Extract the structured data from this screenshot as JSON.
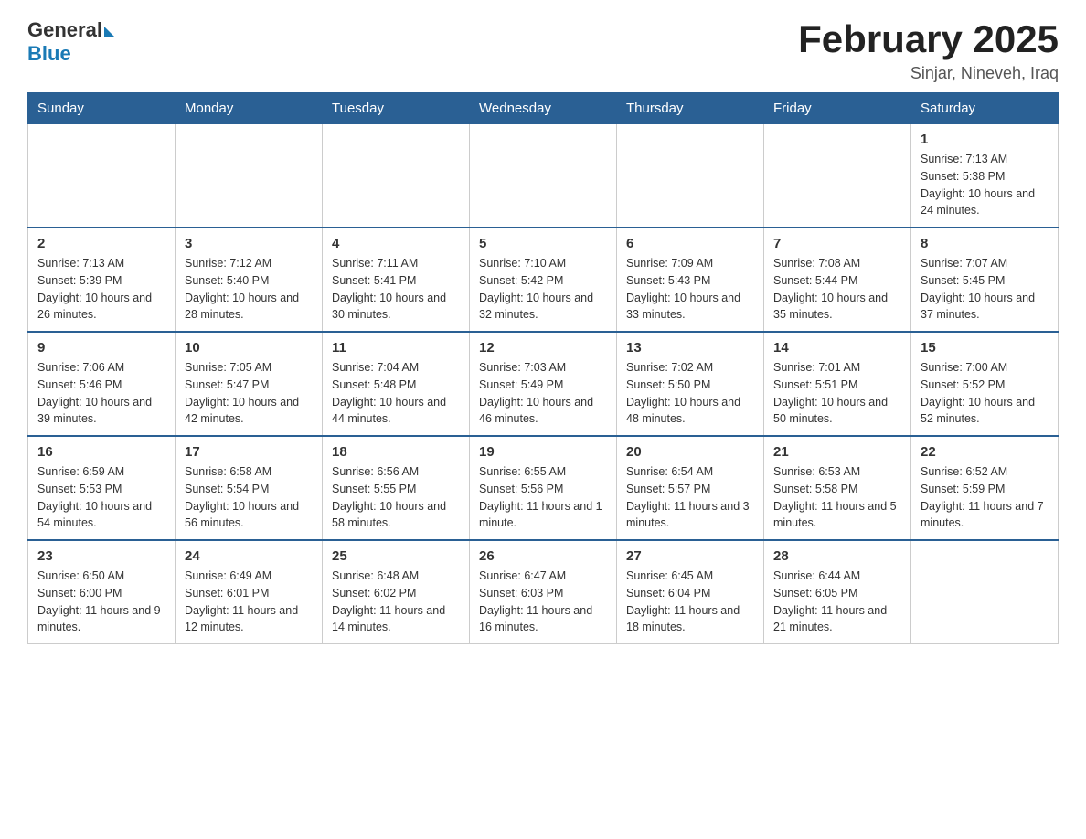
{
  "logo": {
    "general": "General",
    "blue": "Blue"
  },
  "title": "February 2025",
  "location": "Sinjar, Nineveh, Iraq",
  "days_of_week": [
    "Sunday",
    "Monday",
    "Tuesday",
    "Wednesday",
    "Thursday",
    "Friday",
    "Saturday"
  ],
  "weeks": [
    [
      {
        "day": "",
        "sunrise": "",
        "sunset": "",
        "daylight": ""
      },
      {
        "day": "",
        "sunrise": "",
        "sunset": "",
        "daylight": ""
      },
      {
        "day": "",
        "sunrise": "",
        "sunset": "",
        "daylight": ""
      },
      {
        "day": "",
        "sunrise": "",
        "sunset": "",
        "daylight": ""
      },
      {
        "day": "",
        "sunrise": "",
        "sunset": "",
        "daylight": ""
      },
      {
        "day": "",
        "sunrise": "",
        "sunset": "",
        "daylight": ""
      },
      {
        "day": "1",
        "sunrise": "Sunrise: 7:13 AM",
        "sunset": "Sunset: 5:38 PM",
        "daylight": "Daylight: 10 hours and 24 minutes."
      }
    ],
    [
      {
        "day": "2",
        "sunrise": "Sunrise: 7:13 AM",
        "sunset": "Sunset: 5:39 PM",
        "daylight": "Daylight: 10 hours and 26 minutes."
      },
      {
        "day": "3",
        "sunrise": "Sunrise: 7:12 AM",
        "sunset": "Sunset: 5:40 PM",
        "daylight": "Daylight: 10 hours and 28 minutes."
      },
      {
        "day": "4",
        "sunrise": "Sunrise: 7:11 AM",
        "sunset": "Sunset: 5:41 PM",
        "daylight": "Daylight: 10 hours and 30 minutes."
      },
      {
        "day": "5",
        "sunrise": "Sunrise: 7:10 AM",
        "sunset": "Sunset: 5:42 PM",
        "daylight": "Daylight: 10 hours and 32 minutes."
      },
      {
        "day": "6",
        "sunrise": "Sunrise: 7:09 AM",
        "sunset": "Sunset: 5:43 PM",
        "daylight": "Daylight: 10 hours and 33 minutes."
      },
      {
        "day": "7",
        "sunrise": "Sunrise: 7:08 AM",
        "sunset": "Sunset: 5:44 PM",
        "daylight": "Daylight: 10 hours and 35 minutes."
      },
      {
        "day": "8",
        "sunrise": "Sunrise: 7:07 AM",
        "sunset": "Sunset: 5:45 PM",
        "daylight": "Daylight: 10 hours and 37 minutes."
      }
    ],
    [
      {
        "day": "9",
        "sunrise": "Sunrise: 7:06 AM",
        "sunset": "Sunset: 5:46 PM",
        "daylight": "Daylight: 10 hours and 39 minutes."
      },
      {
        "day": "10",
        "sunrise": "Sunrise: 7:05 AM",
        "sunset": "Sunset: 5:47 PM",
        "daylight": "Daylight: 10 hours and 42 minutes."
      },
      {
        "day": "11",
        "sunrise": "Sunrise: 7:04 AM",
        "sunset": "Sunset: 5:48 PM",
        "daylight": "Daylight: 10 hours and 44 minutes."
      },
      {
        "day": "12",
        "sunrise": "Sunrise: 7:03 AM",
        "sunset": "Sunset: 5:49 PM",
        "daylight": "Daylight: 10 hours and 46 minutes."
      },
      {
        "day": "13",
        "sunrise": "Sunrise: 7:02 AM",
        "sunset": "Sunset: 5:50 PM",
        "daylight": "Daylight: 10 hours and 48 minutes."
      },
      {
        "day": "14",
        "sunrise": "Sunrise: 7:01 AM",
        "sunset": "Sunset: 5:51 PM",
        "daylight": "Daylight: 10 hours and 50 minutes."
      },
      {
        "day": "15",
        "sunrise": "Sunrise: 7:00 AM",
        "sunset": "Sunset: 5:52 PM",
        "daylight": "Daylight: 10 hours and 52 minutes."
      }
    ],
    [
      {
        "day": "16",
        "sunrise": "Sunrise: 6:59 AM",
        "sunset": "Sunset: 5:53 PM",
        "daylight": "Daylight: 10 hours and 54 minutes."
      },
      {
        "day": "17",
        "sunrise": "Sunrise: 6:58 AM",
        "sunset": "Sunset: 5:54 PM",
        "daylight": "Daylight: 10 hours and 56 minutes."
      },
      {
        "day": "18",
        "sunrise": "Sunrise: 6:56 AM",
        "sunset": "Sunset: 5:55 PM",
        "daylight": "Daylight: 10 hours and 58 minutes."
      },
      {
        "day": "19",
        "sunrise": "Sunrise: 6:55 AM",
        "sunset": "Sunset: 5:56 PM",
        "daylight": "Daylight: 11 hours and 1 minute."
      },
      {
        "day": "20",
        "sunrise": "Sunrise: 6:54 AM",
        "sunset": "Sunset: 5:57 PM",
        "daylight": "Daylight: 11 hours and 3 minutes."
      },
      {
        "day": "21",
        "sunrise": "Sunrise: 6:53 AM",
        "sunset": "Sunset: 5:58 PM",
        "daylight": "Daylight: 11 hours and 5 minutes."
      },
      {
        "day": "22",
        "sunrise": "Sunrise: 6:52 AM",
        "sunset": "Sunset: 5:59 PM",
        "daylight": "Daylight: 11 hours and 7 minutes."
      }
    ],
    [
      {
        "day": "23",
        "sunrise": "Sunrise: 6:50 AM",
        "sunset": "Sunset: 6:00 PM",
        "daylight": "Daylight: 11 hours and 9 minutes."
      },
      {
        "day": "24",
        "sunrise": "Sunrise: 6:49 AM",
        "sunset": "Sunset: 6:01 PM",
        "daylight": "Daylight: 11 hours and 12 minutes."
      },
      {
        "day": "25",
        "sunrise": "Sunrise: 6:48 AM",
        "sunset": "Sunset: 6:02 PM",
        "daylight": "Daylight: 11 hours and 14 minutes."
      },
      {
        "day": "26",
        "sunrise": "Sunrise: 6:47 AM",
        "sunset": "Sunset: 6:03 PM",
        "daylight": "Daylight: 11 hours and 16 minutes."
      },
      {
        "day": "27",
        "sunrise": "Sunrise: 6:45 AM",
        "sunset": "Sunset: 6:04 PM",
        "daylight": "Daylight: 11 hours and 18 minutes."
      },
      {
        "day": "28",
        "sunrise": "Sunrise: 6:44 AM",
        "sunset": "Sunset: 6:05 PM",
        "daylight": "Daylight: 11 hours and 21 minutes."
      },
      {
        "day": "",
        "sunrise": "",
        "sunset": "",
        "daylight": ""
      }
    ]
  ]
}
